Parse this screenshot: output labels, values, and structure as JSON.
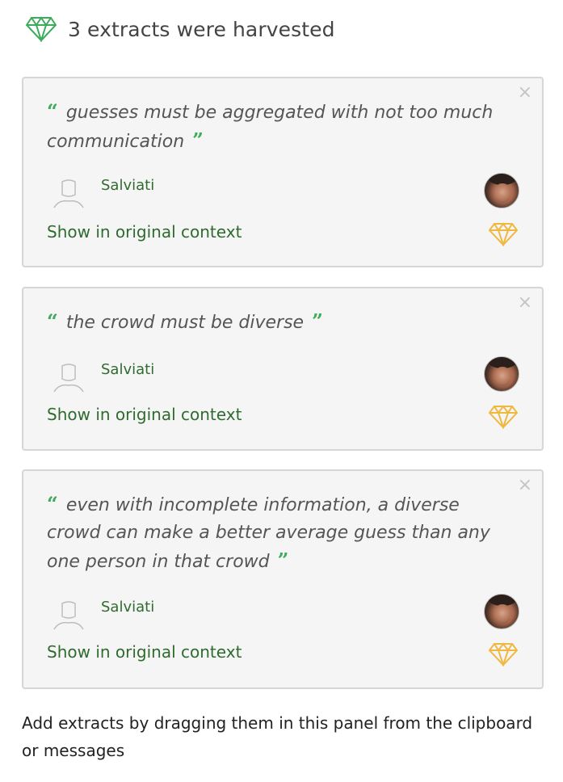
{
  "header": {
    "icon": "diamond-icon",
    "icon_color": "#3dab5c",
    "title": "3 extracts were harvested"
  },
  "extracts": [
    {
      "quote": "guesses must be aggregated with not too much communication",
      "author": "Salviati",
      "context_link": "Show in original context",
      "close_label": "×"
    },
    {
      "quote": "the crowd must be diverse",
      "author": "Salviati",
      "context_link": "Show in original context",
      "close_label": "×"
    },
    {
      "quote": "even with incomplete information, a diverse crowd can make a better average guess than any one person in that crowd",
      "author": "Salviati",
      "context_link": "Show in original context",
      "close_label": "×"
    }
  ],
  "quote_marks": {
    "open": "“",
    "close": "”"
  },
  "footer": {
    "hint": "Add extracts by dragging them in this panel from the clipboard or messages"
  },
  "colors": {
    "accent_green": "#3dab5c",
    "link_green": "#2f6b2f",
    "gold": "#f0b840",
    "card_bg": "#f5f5f5"
  }
}
